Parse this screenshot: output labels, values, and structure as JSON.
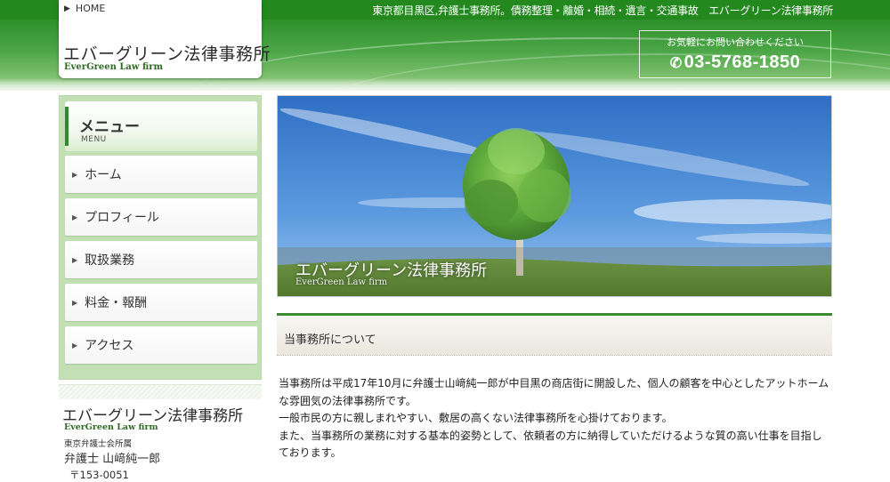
{
  "header": {
    "home_label": "HOME",
    "tagline": "東京都目黒区,弁護士事務所。債務整理・離婚・相続・遺言・交通事故　エバーグリーン法律事務所",
    "logo_title": "エバーグリーン法律事務所",
    "logo_subtitle": "EverGreen Law firm",
    "contact_note": "お気軽にお問い合わせください",
    "contact_phone": "03-5768-1850",
    "colors": {
      "header_green": "#2d8f2a",
      "accent_green": "#3d8a33"
    }
  },
  "sidebar": {
    "menu_title": "メニュー",
    "menu_subtitle": "MENU",
    "items": [
      {
        "label": "ホーム"
      },
      {
        "label": "プロフィール"
      },
      {
        "label": "取扱業務"
      },
      {
        "label": "料金・報酬"
      },
      {
        "label": "アクセス"
      }
    ],
    "info": {
      "name": "エバーグリーン法律事務所",
      "subtitle": "EverGreen Law firm",
      "association": "東京弁護士会所属",
      "lawyer": "弁護士 山﨑純一郎",
      "postal": "〒153-0051"
    }
  },
  "hero": {
    "title": "エバーグリーン法律事務所",
    "subtitle": "EverGreen Law firm"
  },
  "main": {
    "section_title": "当事務所について",
    "paragraphs": [
      "当事務所は平成17年10月に弁護士山﨑純一郎が中目黒の商店街に開設した、個人の顧客を中心としたアットホームな雰囲気の法律事務所です。",
      "一般市民の方に親しまれやすい、敷居の高くない法律事務所を心掛けております。",
      "また、当事務所の業務に対する基本的姿勢として、依頼者の方に納得していただけるような質の高い仕事を目指しております。"
    ]
  },
  "icons": [
    "home-arrow-icon",
    "phone-icon",
    "menu-triangle-icon",
    "tree-photo"
  ]
}
